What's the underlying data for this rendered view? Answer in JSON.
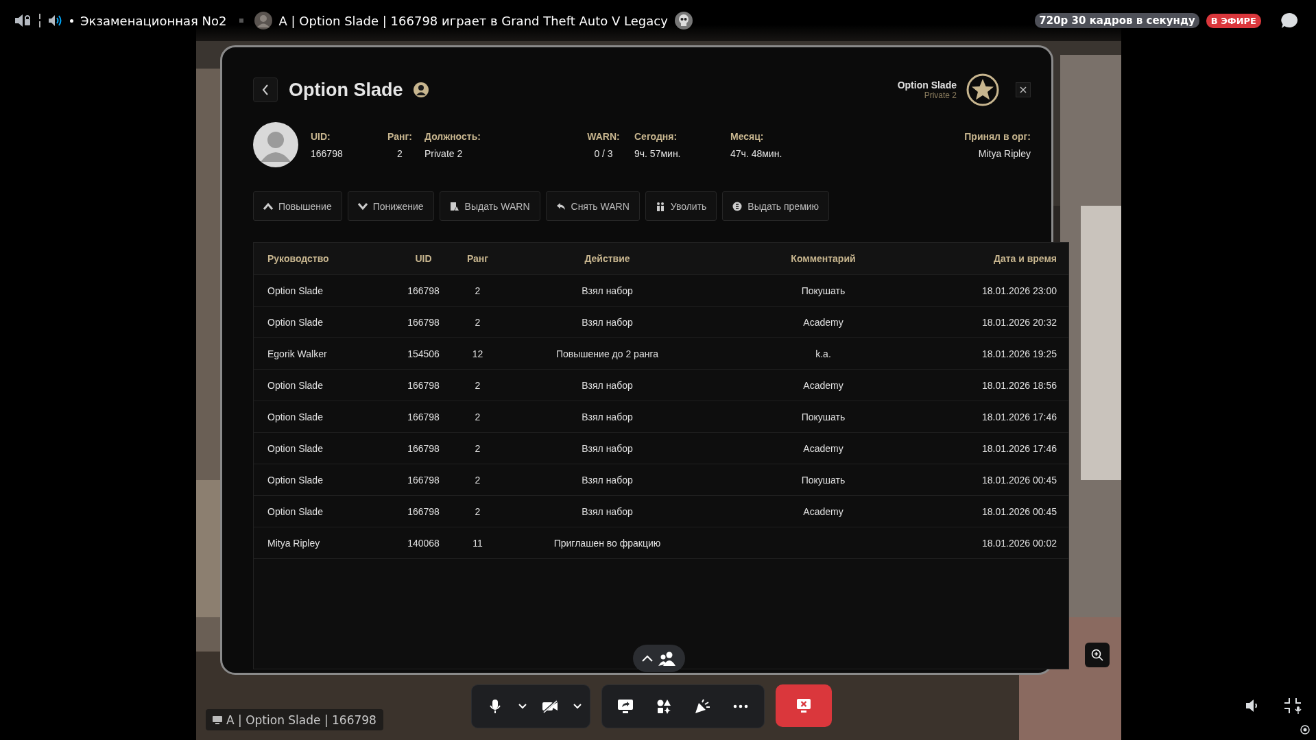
{
  "top_bar": {
    "channel": "Экзаменационная No2",
    "stream_title": "A | Option Slade | 166798 играет в Grand Theft Auto V Legacy",
    "quality": "720p 30 кадров в секунду",
    "live_badge": "В ЭФИРЕ"
  },
  "panel": {
    "title": "Option Slade",
    "corner_name": "Option Slade",
    "corner_rank": "Private 2",
    "info": [
      {
        "label": "UID:",
        "value": "166798"
      },
      {
        "label": "Ранг:",
        "value": "2"
      },
      {
        "label": "Должность:",
        "value": "Private 2"
      },
      {
        "label": "WARN:",
        "value": "0 / 3"
      },
      {
        "label": "Сегодня:",
        "value": "9ч. 57мин."
      },
      {
        "label": "Месяц:",
        "value": "47ч. 48мин."
      },
      {
        "label": "Принял в орг:",
        "value": "Mitya Ripley"
      }
    ],
    "actions": [
      {
        "label": "Повышение",
        "kind": "up"
      },
      {
        "label": "Понижение",
        "kind": "down"
      },
      {
        "label": "Выдать WARN",
        "kind": "warn"
      },
      {
        "label": "Снять WARN",
        "kind": "undo"
      },
      {
        "label": "Уволить",
        "kind": "fire"
      },
      {
        "label": "Выдать премию",
        "kind": "bonus"
      }
    ],
    "table": {
      "columns": [
        "Руководство",
        "UID",
        "Ранг",
        "Действие",
        "Комментарий",
        "Дата и время"
      ],
      "rows": [
        [
          "Option Slade",
          "166798",
          "2",
          "Взял набор",
          "Покушать",
          "18.01.2026 23:00"
        ],
        [
          "Option Slade",
          "166798",
          "2",
          "Взял набор",
          "Academy",
          "18.01.2026 20:32"
        ],
        [
          "Egorik Walker",
          "154506",
          "12",
          "Повышение до 2 ранга",
          "k.a.",
          "18.01.2026 19:25"
        ],
        [
          "Option Slade",
          "166798",
          "2",
          "Взял набор",
          "Academy",
          "18.01.2026 18:56"
        ],
        [
          "Option Slade",
          "166798",
          "2",
          "Взял набор",
          "Покушать",
          "18.01.2026 17:46"
        ],
        [
          "Option Slade",
          "166798",
          "2",
          "Взял набор",
          "Academy",
          "18.01.2026 17:46"
        ],
        [
          "Option Slade",
          "166798",
          "2",
          "Взял набор",
          "Покушать",
          "18.01.2026 00:45"
        ],
        [
          "Option Slade",
          "166798",
          "2",
          "Взял набор",
          "Academy",
          "18.01.2026 00:45"
        ],
        [
          "Mitya Ripley",
          "140068",
          "11",
          "Приглашен во фракцию",
          "",
          "18.01.2026 00:02"
        ]
      ]
    }
  },
  "stream_name_tag": "A | Option Slade | 166798",
  "participants_expanded": false
}
